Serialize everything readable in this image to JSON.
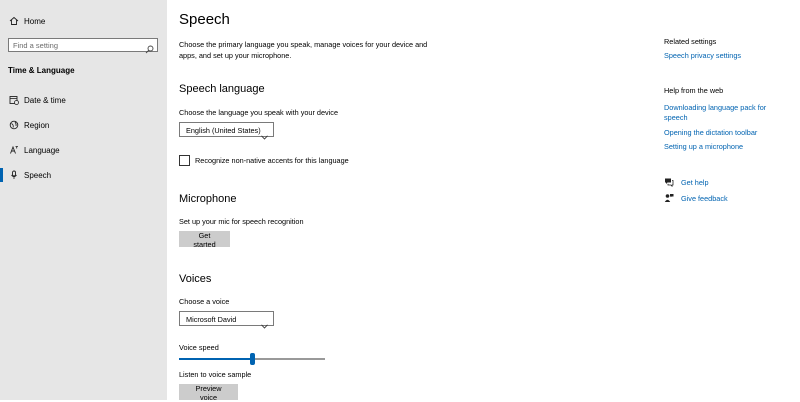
{
  "sidebar": {
    "home_label": "Home",
    "search_placeholder": "Find a setting",
    "section_title": "Time & Language",
    "items": [
      {
        "label": "Date & time",
        "icon": "calendar-clock-icon"
      },
      {
        "label": "Region",
        "icon": "globe-icon"
      },
      {
        "label": "Language",
        "icon": "language-icon"
      },
      {
        "label": "Speech",
        "icon": "microphone-icon",
        "active": true
      }
    ]
  },
  "main": {
    "title": "Speech",
    "intro": "Choose the primary language you speak, manage voices for your device and apps, and set up your microphone.",
    "speech_language": {
      "heading": "Speech language",
      "prompt": "Choose the language you speak with your device",
      "selected": "English (United States)",
      "checkbox_label": "Recognize non-native accents for this language",
      "checkbox_checked": false
    },
    "microphone": {
      "heading": "Microphone",
      "prompt": "Set up your mic for speech recognition",
      "button": "Get started"
    },
    "voices": {
      "heading": "Voices",
      "prompt": "Choose a voice",
      "selected": "Microsoft David",
      "speed_label": "Voice speed",
      "speed_value": 0.5,
      "sample_label": "Listen to voice sample",
      "preview_button": "Preview voice"
    }
  },
  "right_panel": {
    "related_heading": "Related settings",
    "related_links": [
      "Speech privacy settings"
    ],
    "help_heading": "Help from the web",
    "help_links": [
      "Downloading language pack for speech",
      "Opening the dictation toolbar",
      "Setting up a microphone"
    ],
    "get_help": "Get help",
    "give_feedback": "Give feedback"
  },
  "colors": {
    "accent": "#0063b1",
    "sidebar_bg": "#e6e6e6",
    "button_bg": "#cccccc"
  }
}
